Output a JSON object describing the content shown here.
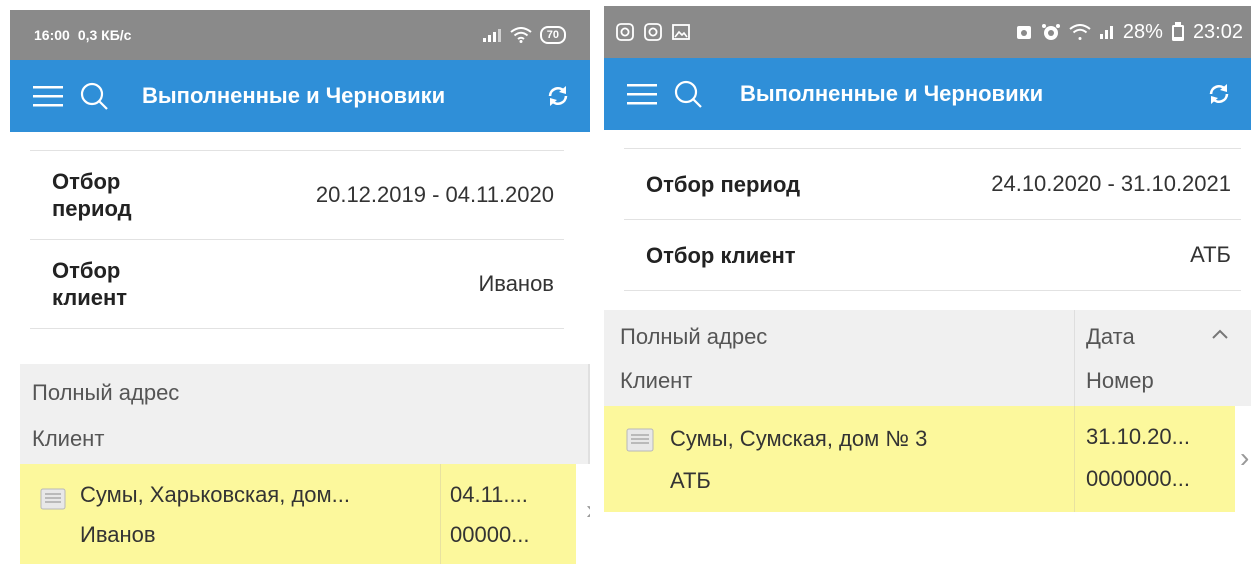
{
  "screens": [
    {
      "status_bar": {
        "time": "16:00",
        "speed": "0,3 КБ/с",
        "battery": "70"
      },
      "app_bar": {
        "title": "Выполненные и Черновики"
      },
      "filters": [
        {
          "label": "Отбор период",
          "value": "20.12.2019 - 04.11.2020"
        },
        {
          "label": "Отбор клиент",
          "value": "Иванов"
        }
      ],
      "table": {
        "header": {
          "col1_line1": "Полный адрес",
          "col1_line2": "Клиент"
        },
        "rows": [
          {
            "address": "Сумы, Харьковская, дом...",
            "client": "Иванов",
            "date": "04.11....",
            "number": "00000..."
          }
        ]
      }
    },
    {
      "status_bar": {
        "battery_percent": "28%",
        "time": "23:02"
      },
      "app_bar": {
        "title": "Выполненные и Черновики"
      },
      "filters": [
        {
          "label": "Отбор период",
          "value": "24.10.2020 - 31.10.2021"
        },
        {
          "label": "Отбор клиент",
          "value": "АТБ"
        }
      ],
      "table": {
        "header": {
          "col1_line1": "Полный адрес",
          "col1_line2": "Клиент",
          "col2_line1": "Дата",
          "col2_line2": "Номер"
        },
        "rows": [
          {
            "address": "Сумы, Сумская, дом № 3",
            "client": "АТБ",
            "date": "31.10.20...",
            "number": "0000000..."
          }
        ]
      }
    }
  ],
  "colors": {
    "app_bar": "#2f8fd8",
    "status_bar": "#8a8a8a",
    "row_highlight": "#fcf89c",
    "header_bg": "#f0f0f0"
  },
  "icons": [
    "hamburger-menu-icon",
    "search-icon",
    "refresh-icon",
    "document-icon",
    "chevron-right-icon",
    "chevron-up-icon",
    "wifi-icon",
    "signal-icon",
    "battery-icon",
    "instagram-icon",
    "gallery-icon",
    "alarm-icon"
  ]
}
